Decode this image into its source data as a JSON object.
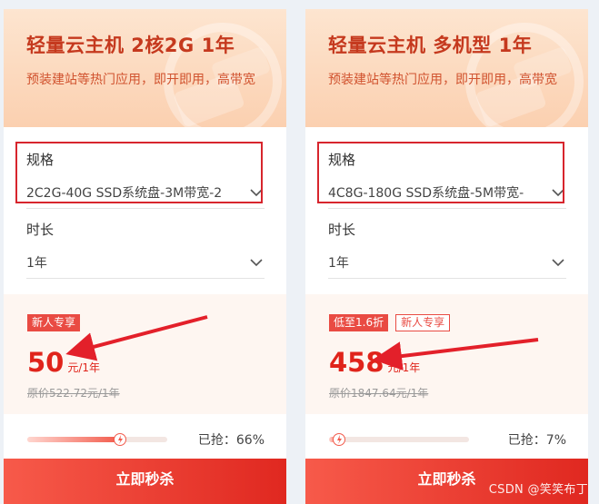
{
  "cards": [
    {
      "title": "轻量云主机 2核2G 1年",
      "desc": "预装建站等热门应用，即开即用，高带宽",
      "spec_label": "规格",
      "spec_value": "2C2G-40G SSD系统盘-3M带宽-2",
      "duration_label": "时长",
      "duration_value": "1年",
      "tags": [
        "新人专享"
      ],
      "price": "50",
      "price_unit": "元/1年",
      "original": "原价522.72元/1年",
      "sold_label": "已抢：66%",
      "sold_fraction": 0.66,
      "buy_label": "立即秒杀"
    },
    {
      "title": "轻量云主机 多机型 1年",
      "desc": "预装建站等热门应用，即开即用，高带宽",
      "spec_label": "规格",
      "spec_value": "4C8G-180G SSD系统盘-5M带宽-",
      "duration_label": "时长",
      "duration_value": "1年",
      "tags": [
        "低至1.6折",
        "新人专享"
      ],
      "price": "458",
      "price_unit": "元/1年",
      "original": "原价1847.64元/1年",
      "sold_label": "已抢：7%",
      "sold_fraction": 0.07,
      "buy_label": "立即秒杀"
    }
  ],
  "watermark": "CSDN @笑笑布丁",
  "colors": {
    "accent": "#e0241b",
    "highlight_box": "#d7252d",
    "header_bg": "#fbd0b0"
  }
}
